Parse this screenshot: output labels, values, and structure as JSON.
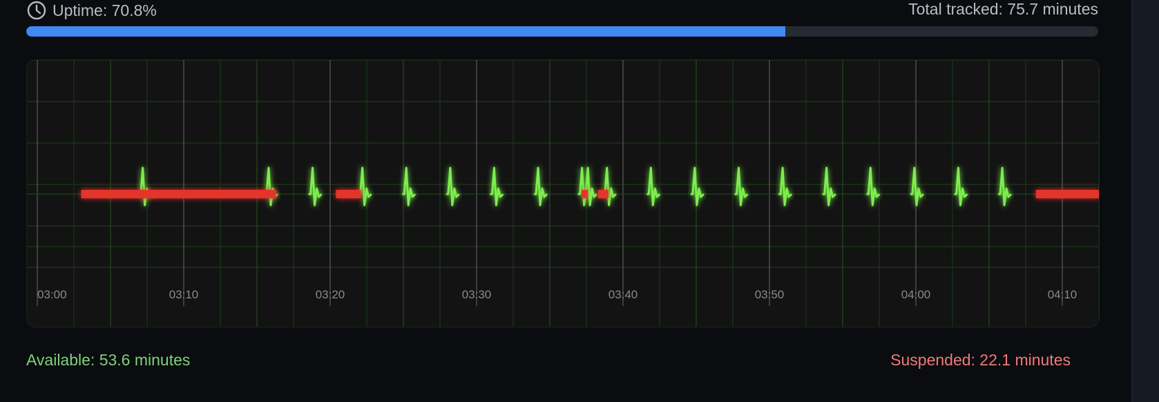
{
  "header": {
    "uptime_label": "Uptime: 70.8%",
    "total_label": "Total tracked: 75.7 minutes"
  },
  "progress": {
    "uptime_fraction": 0.708,
    "fill_color": "#3f89f0",
    "track_color": "#262a31"
  },
  "footer": {
    "available_label": "Available: 53.6 minutes",
    "suspended_label": "Suspended: 22.1 minutes"
  },
  "icons": {
    "uptime_icon": "clock-icon"
  },
  "colors": {
    "available": "#7dee4e",
    "suspended": "#e5352a"
  },
  "chart_data": {
    "type": "line",
    "x_ticks": [
      "03:00",
      "03:10",
      "03:20",
      "03:30",
      "03:40",
      "03:50",
      "04:00",
      "04:10"
    ],
    "x_range_minutes": [
      180,
      252.5
    ],
    "suspended_intervals": [
      [
        "03:03",
        "03:16.3"
      ],
      [
        "03:20.4",
        "03:22.1"
      ],
      [
        "03:37.2",
        "03:37.6"
      ],
      [
        "03:38.3",
        "03:39"
      ],
      [
        "04:08.2",
        "04:15"
      ]
    ],
    "heartbeats": [
      "03:07.2",
      "03:15.8",
      "03:18.8",
      "03:22.2",
      "03:25.2",
      "03:28.2",
      "03:31.2",
      "03:34.2",
      "03:37.2",
      "03:37.6",
      "03:38.9",
      "03:41.9",
      "03:44.9",
      "03:47.9",
      "03:50.9",
      "03:53.9",
      "03:56.9",
      "03:59.9",
      "04:02.9",
      "04:05.9"
    ],
    "grid": true
  }
}
